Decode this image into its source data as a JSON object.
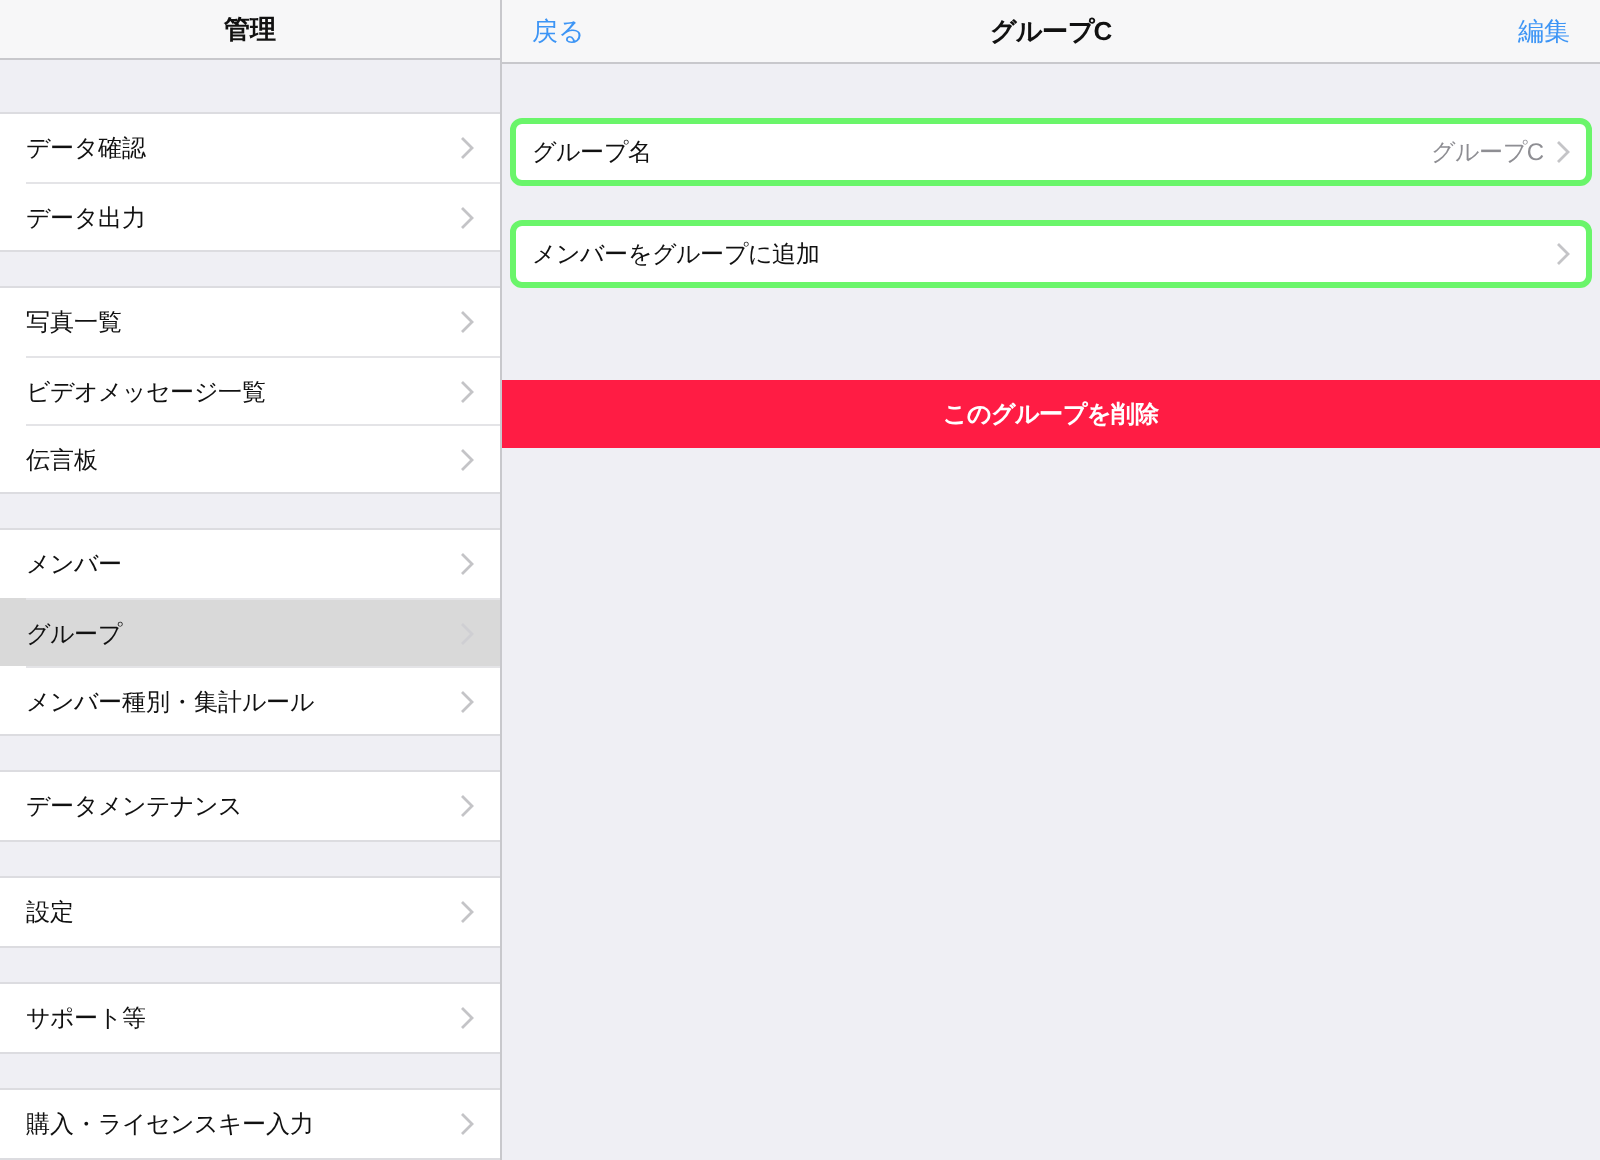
{
  "sidebar": {
    "title": "管理",
    "sections": [
      {
        "items": [
          {
            "label": "データ確認",
            "selected": false
          },
          {
            "label": "データ出力",
            "selected": false
          }
        ]
      },
      {
        "items": [
          {
            "label": "写真一覧",
            "selected": false
          },
          {
            "label": "ビデオメッセージ一覧",
            "selected": false
          },
          {
            "label": "伝言板",
            "selected": false
          }
        ]
      },
      {
        "items": [
          {
            "label": "メンバー",
            "selected": false
          },
          {
            "label": "グループ",
            "selected": true
          },
          {
            "label": "メンバー種別・集計ルール",
            "selected": false
          }
        ]
      },
      {
        "items": [
          {
            "label": "データメンテナンス",
            "selected": false
          }
        ]
      },
      {
        "items": [
          {
            "label": "設定",
            "selected": false
          }
        ]
      },
      {
        "items": [
          {
            "label": "サポート等",
            "selected": false
          }
        ]
      },
      {
        "items": [
          {
            "label": "購入・ライセンスキー入力",
            "selected": false
          }
        ]
      }
    ]
  },
  "detail": {
    "back": "戻る",
    "title": "グループC",
    "edit": "編集",
    "rows": [
      {
        "label": "グループ名",
        "value": "グループC",
        "highlighted": true
      },
      {
        "label": "メンバーをグループに追加",
        "highlighted": true
      }
    ],
    "delete_button": "このグループを削除"
  }
}
